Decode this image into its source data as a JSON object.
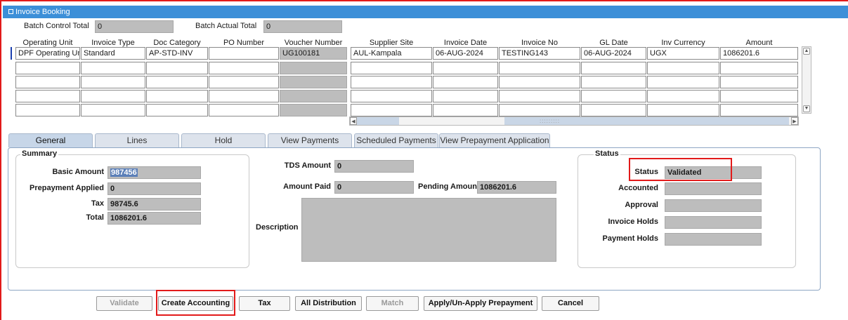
{
  "window": {
    "title": "Invoice Booking"
  },
  "batch": {
    "control_label": "Batch Control Total",
    "control_value": "0",
    "actual_label": "Batch Actual Total",
    "actual_value": "0"
  },
  "grid": {
    "columns": [
      "Operating Unit",
      "Invoice Type",
      "Doc Category",
      "PO Number",
      "Voucher Number",
      "Supplier Site",
      "Invoice Date",
      "Invoice No",
      "GL Date",
      "Inv Currency",
      "Amount"
    ],
    "row1": [
      "DPF Operating Uni",
      "Standard",
      "AP-STD-INV",
      "",
      "UG100181",
      "AUL-Kampala",
      "06-AUG-2024",
      "TESTING143",
      "06-AUG-2024",
      "UGX",
      "1086201.6"
    ]
  },
  "tabs": [
    "General",
    "Lines",
    "Hold",
    "View Payments",
    "Scheduled Payments",
    "View Prepayment Application"
  ],
  "summary": {
    "title": "Summary",
    "basic_amount_label": "Basic Amount",
    "basic_amount": "987456",
    "prepayment_label": "Prepayment Applied",
    "prepayment": "0",
    "tax_label": "Tax",
    "tax": "98745.6",
    "total_label": "Total",
    "total": "1086201.6"
  },
  "middle": {
    "tds_label": "TDS Amount",
    "tds": "0",
    "amount_paid_label": "Amount Paid",
    "amount_paid": "0",
    "pending_label": "Pending Amount",
    "pending": "1086201.6",
    "description_label": "Description",
    "description": ""
  },
  "status": {
    "title": "Status",
    "status_label": "Status",
    "status_value": "Validated",
    "accounted_label": "Accounted",
    "accounted": "",
    "approval_label": "Approval",
    "approval": "",
    "invoice_holds_label": "Invoice Holds",
    "invoice_holds": "",
    "payment_holds_label": "Payment Holds",
    "payment_holds": ""
  },
  "buttons": {
    "validate": "Validate",
    "create_accounting": "Create Accounting",
    "tax": "Tax",
    "all_distribution": "All Distribution",
    "match": "Match",
    "apply_prepayment": "Apply/Un-Apply Prepayment",
    "cancel": "Cancel"
  },
  "colors": {
    "titlebar": "#3c8fd8",
    "highlight": "#e21a1a",
    "readonly_field": "#bdbdbd",
    "selected_text_bg": "#5b7fb8"
  }
}
